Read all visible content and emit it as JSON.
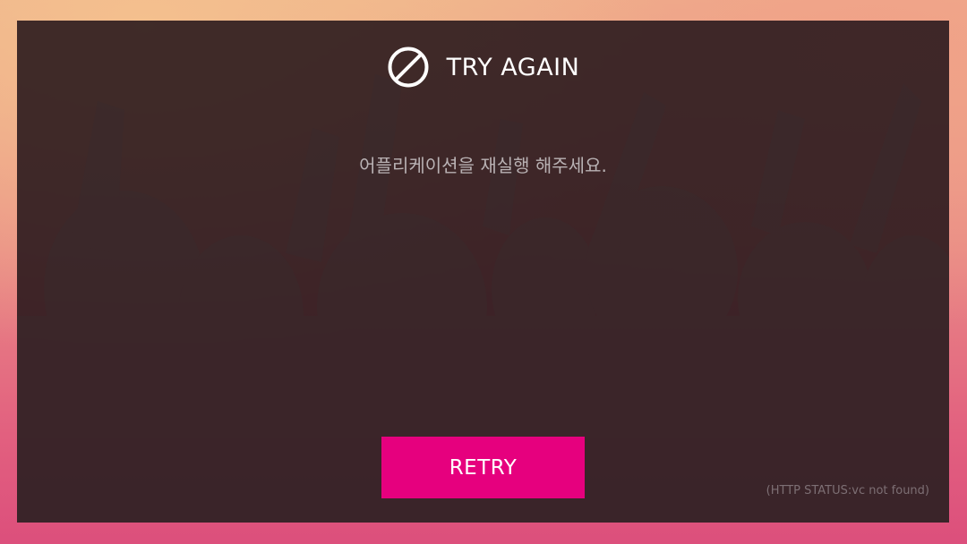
{
  "dialog": {
    "icon": "ban-icon",
    "title": "TRY AGAIN",
    "message": "어플리케이션을 재실행 해주세요.",
    "retry_label": "RETRY",
    "status": "(HTTP STATUS:vc not found)"
  },
  "colors": {
    "accent": "#e6007e",
    "panel": "#26161a",
    "title_text": "#ffffff",
    "message_text": "#b9b2b4",
    "status_text": "#7d6f74"
  }
}
